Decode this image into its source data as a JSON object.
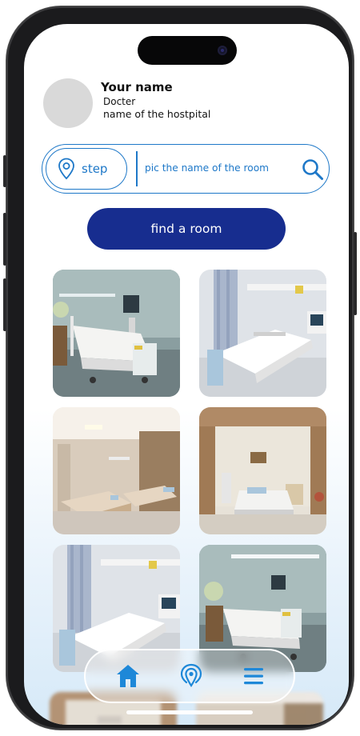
{
  "profile": {
    "name": "Your name",
    "role": "Docter",
    "hospital": "name of the hostpital"
  },
  "search": {
    "step_label": "step",
    "placeholder": "pic the name of the room"
  },
  "cta": {
    "label": "find a room"
  },
  "rooms": [
    {
      "variant": "teal-room-with-monitor"
    },
    {
      "variant": "white-room-with-curtain"
    },
    {
      "variant": "wood-room-two-beds"
    },
    {
      "variant": "wood-room-single-bed"
    },
    {
      "variant": "white-room-with-curtain"
    },
    {
      "variant": "teal-room-with-monitor"
    }
  ],
  "nav": {
    "items": [
      {
        "icon": "home-icon",
        "active": true
      },
      {
        "icon": "location-icon",
        "active": false
      },
      {
        "icon": "menu-icon",
        "active": false
      }
    ]
  },
  "colors": {
    "accent": "#1e78c8",
    "primary_button": "#172d8f",
    "nav_icon": "#1e88d8"
  }
}
